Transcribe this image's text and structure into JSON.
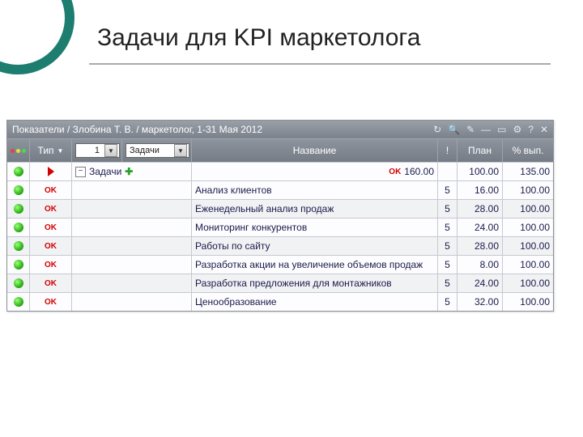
{
  "slide": {
    "title": "Задачи для KPI маркетолога"
  },
  "window": {
    "title": "Показатели / Злобина Т. В. / маркетолог, 1-31 Мая 2012"
  },
  "header": {
    "type_label": "Тип",
    "sort_value": "1",
    "category_value": "Задачи",
    "name_label": "Название",
    "priority_label": "!",
    "plan_label": "План",
    "pct_label": "% вып."
  },
  "parent_row": {
    "name": "Задачи",
    "ok": "OK",
    "value": "160.00",
    "plan": "100.00",
    "pct": "135.00"
  },
  "rows": [
    {
      "status": "OK",
      "name": "Анализ клиентов",
      "pri": "5",
      "plan": "16.00",
      "pct": "100.00"
    },
    {
      "status": "OK",
      "name": "Еженедельный анализ продаж",
      "pri": "5",
      "plan": "28.00",
      "pct": "100.00"
    },
    {
      "status": "OK",
      "name": "Мониторинг конкурентов",
      "pri": "5",
      "plan": "24.00",
      "pct": "100.00"
    },
    {
      "status": "OK",
      "name": "Работы по сайту",
      "pri": "5",
      "plan": "28.00",
      "pct": "100.00"
    },
    {
      "status": "OK",
      "name": "Разработка акции на увеличение объемов продаж",
      "pri": "5",
      "plan": "8.00",
      "pct": "100.00"
    },
    {
      "status": "OK",
      "name": "Разработка предложения для монтажников",
      "pri": "5",
      "plan": "24.00",
      "pct": "100.00"
    },
    {
      "status": "OK",
      "name": "Ценообразование",
      "pri": "5",
      "plan": "32.00",
      "pct": "100.00"
    }
  ]
}
